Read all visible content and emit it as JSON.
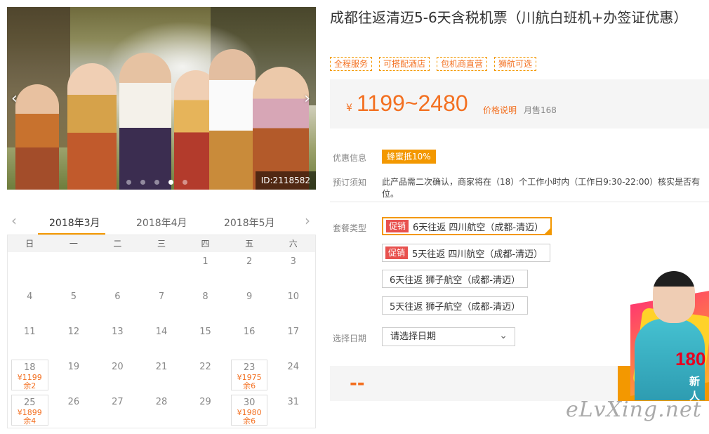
{
  "gallery": {
    "prev_arrow": "‹",
    "next_arrow": "›",
    "image_id": "ID:2118582",
    "dot_count": 5,
    "active_dot": 3
  },
  "calendar": {
    "prev_arrow": "‹",
    "next_arrow": "›",
    "months": [
      "2018年3月",
      "2018年4月",
      "2018年5月"
    ],
    "active_month": 0,
    "weekdays": [
      "日",
      "一",
      "二",
      "三",
      "四",
      "五",
      "六"
    ],
    "days": [
      {
        "d": ""
      },
      {
        "d": ""
      },
      {
        "d": ""
      },
      {
        "d": ""
      },
      {
        "d": "1"
      },
      {
        "d": "2"
      },
      {
        "d": "3"
      },
      {
        "d": "4"
      },
      {
        "d": "5"
      },
      {
        "d": "6"
      },
      {
        "d": "7"
      },
      {
        "d": "8"
      },
      {
        "d": "9"
      },
      {
        "d": "10"
      },
      {
        "d": "11"
      },
      {
        "d": "12"
      },
      {
        "d": "13"
      },
      {
        "d": "14"
      },
      {
        "d": "15"
      },
      {
        "d": "16"
      },
      {
        "d": "17"
      },
      {
        "d": "18",
        "price": "¥1199",
        "left": "余2"
      },
      {
        "d": "19"
      },
      {
        "d": "20"
      },
      {
        "d": "21"
      },
      {
        "d": "22"
      },
      {
        "d": "23",
        "price": "¥1975",
        "left": "余6"
      },
      {
        "d": "24"
      },
      {
        "d": "25",
        "price": "¥1899",
        "left": "余4"
      },
      {
        "d": "26"
      },
      {
        "d": "27"
      },
      {
        "d": "28"
      },
      {
        "d": "29"
      },
      {
        "d": "30",
        "price": "¥1980",
        "left": "余6"
      },
      {
        "d": "31"
      }
    ]
  },
  "product": {
    "title": "成都往返清迈5-6天含税机票（川航白班机+办签证优惠）",
    "tags": [
      "全程服务",
      "可搭配酒店",
      "包机商直营",
      "狮航可选"
    ],
    "price_symbol": "¥",
    "price_range": "1199~2480",
    "price_explain": "价格说明",
    "monthly_sales": "月售168",
    "discount_label": "优惠信息",
    "discount_badge": "蜂蜜抵10%",
    "notice_label": "预订须知",
    "notice_text": "此产品需二次确认，商家将在（18）个工作小时内（工作日9:30-22:00）核实是否有位。",
    "package_label": "套餐类型",
    "packages": [
      {
        "promo": "促销",
        "label": "6天往返 四川航空（成都-清迈）",
        "selected": true
      },
      {
        "promo": "促销",
        "label": "5天往返 四川航空（成都-清迈）",
        "selected": false
      },
      {
        "promo": "",
        "label": "6天往返 狮子航空（成都-清迈）",
        "selected": false
      },
      {
        "promo": "",
        "label": "5天往返 狮子航空（成都-清迈）",
        "selected": false
      }
    ],
    "date_label": "选择日期",
    "date_placeholder": "请选择日期",
    "bottom_price": "--"
  },
  "promo_art": {
    "big_text": "180",
    "small_text": "新人"
  },
  "watermark": "eLvXing.net",
  "colors": {
    "accent": "#f39800",
    "price": "#f37021",
    "promo": "#e8514e"
  }
}
